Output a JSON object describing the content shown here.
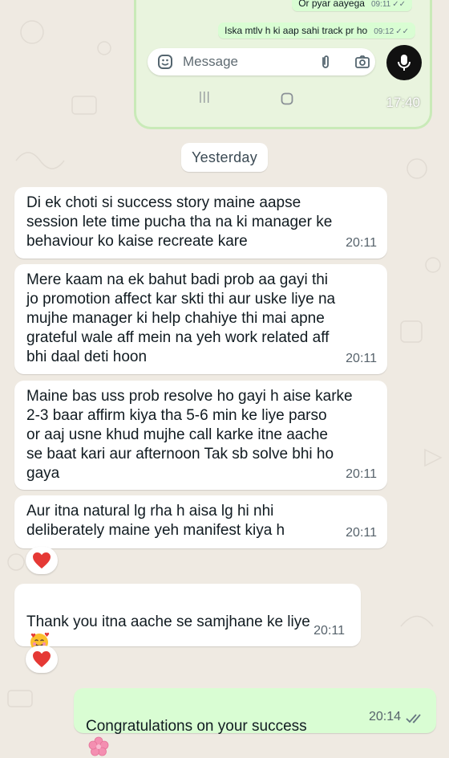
{
  "embedded_screenshot": {
    "messages": [
      {
        "text": "Or pyar aayega",
        "time": "09:11"
      },
      {
        "text": "Iska mtlv h ki aap sahi track pr ho",
        "time": "09:12"
      }
    ],
    "input_placeholder": "Message",
    "status_time": "17:40",
    "nav": {
      "recents": "|||"
    }
  },
  "date_separator": "Yesterday",
  "messages": [
    {
      "direction": "incoming",
      "text": "Di ek choti si success story maine aapse\nsession lete time pucha tha na ki manager ke\nbehaviour ko kaise recreate kare",
      "time": "20:11"
    },
    {
      "direction": "incoming",
      "text": "Mere kaam na ek bahut badi prob aa gayi thi\njo promotion affect kar skti thi aur uske liye na\nmujhe manager ki help chahiye thi mai apne\ngrateful wale aff mein na yeh work related aff\nbhi daal deti hoon",
      "time": "20:11"
    },
    {
      "direction": "incoming",
      "text": "Maine bas uss prob resolve ho gayi h aise karke\n2-3 baar affirm kiya tha 5-6 min ke liye parso\nor aaj usne khud mujhe call karke itne aache\nse baat kari aur afternoon Tak sb solve bhi ho\ngaya",
      "time": "20:11"
    },
    {
      "direction": "incoming",
      "text": "Aur itna natural lg rha h aisa lg hi nhi\ndeliberately maine yeh manifest kiya h",
      "time": "20:11",
      "reaction": "red-heart"
    },
    {
      "direction": "incoming",
      "text": "Thank you itna aache se samjhane ke liye",
      "emoji": "smiling-face-with-hearts",
      "time": "20:11",
      "reaction": "red-heart"
    },
    {
      "direction": "outgoing",
      "text": "Congratulations on your success",
      "emoji": "cherry-blossom",
      "time": "20:14",
      "status": "read"
    }
  ],
  "colors": {
    "background": "#efeae2",
    "incoming_bubble": "#ffffff",
    "outgoing_bubble": "#d9fdd3",
    "read_ticks": "#53bdeb",
    "timestamp": "#56626b"
  }
}
